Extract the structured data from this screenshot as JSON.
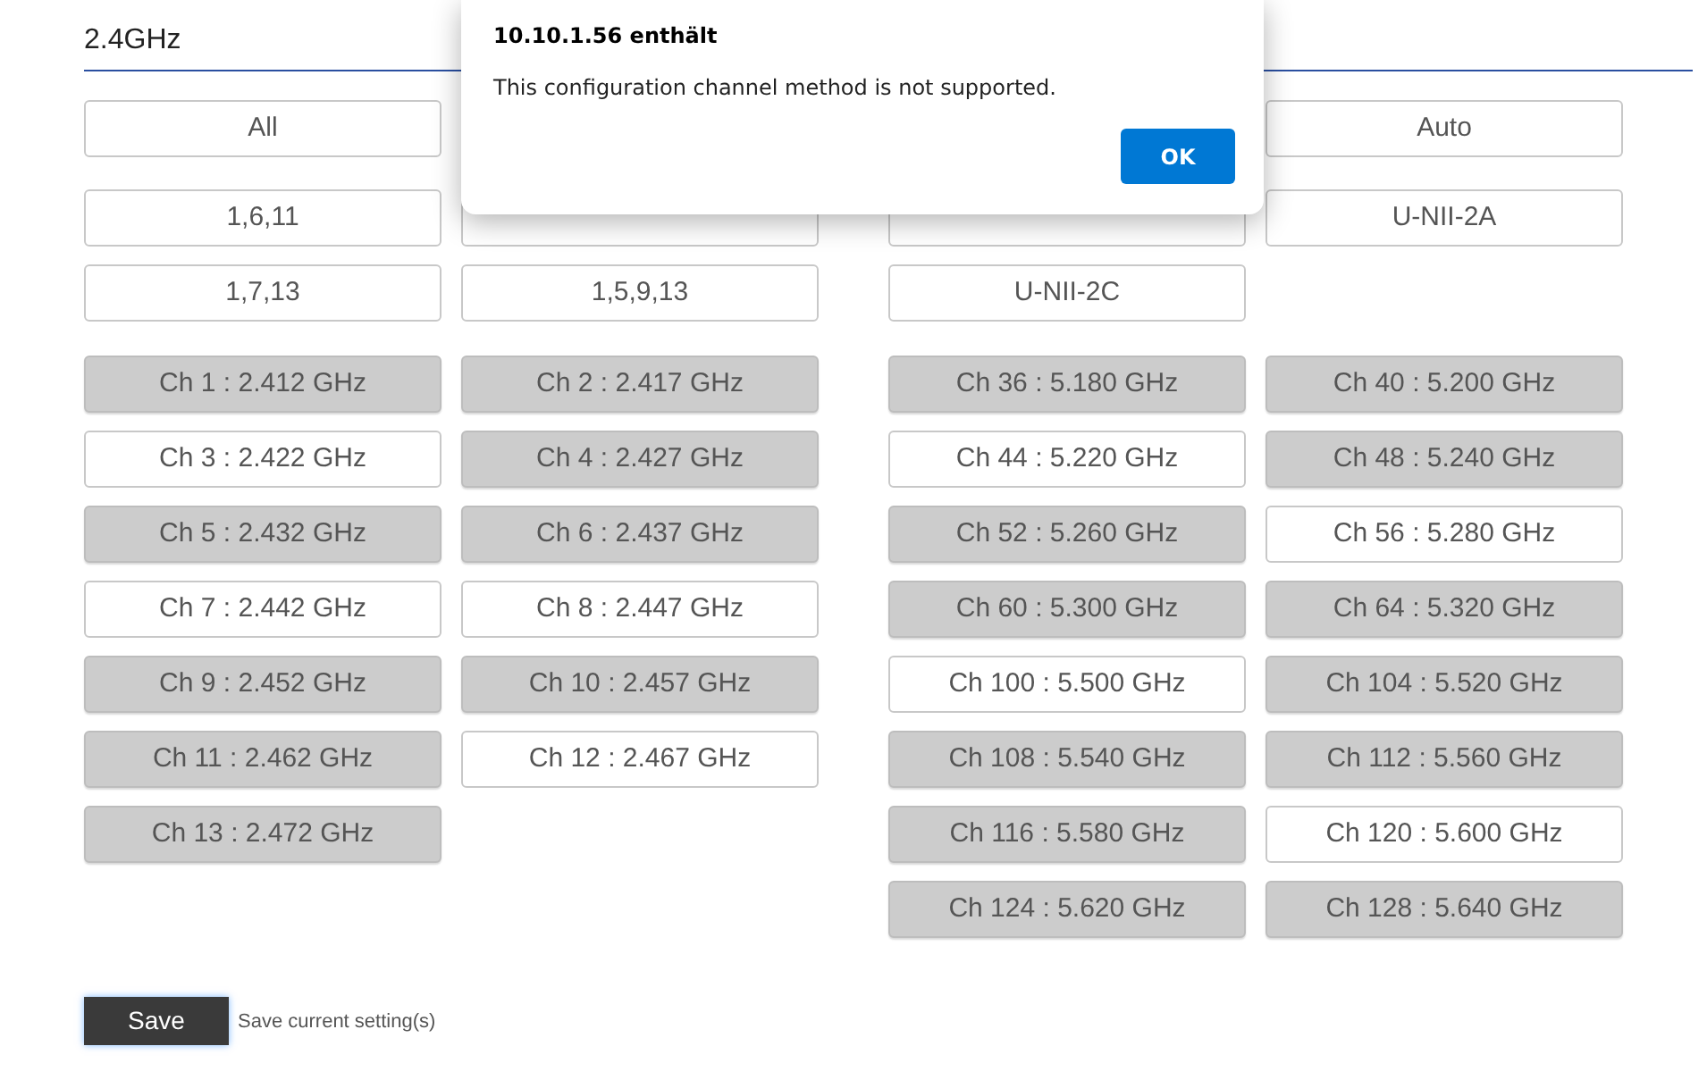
{
  "section": {
    "title": "2.4GHz"
  },
  "bands": [
    {
      "presets": [
        [
          {
            "kind": "button",
            "label": "All"
          }
        ],
        [
          {
            "kind": "button",
            "label": "1,6,11"
          },
          {
            "kind": "covered"
          }
        ],
        [
          {
            "kind": "button",
            "label": "1,7,13"
          },
          {
            "kind": "button",
            "label": "1,5,9,13"
          }
        ]
      ],
      "channels": [
        {
          "label": "Ch 1 : 2.412 GHz",
          "selected": true
        },
        {
          "label": "Ch 2 : 2.417 GHz",
          "selected": true
        },
        {
          "label": "Ch 3 : 2.422 GHz",
          "selected": false
        },
        {
          "label": "Ch 4 : 2.427 GHz",
          "selected": true
        },
        {
          "label": "Ch 5 : 2.432 GHz",
          "selected": true
        },
        {
          "label": "Ch 6 : 2.437 GHz",
          "selected": true
        },
        {
          "label": "Ch 7 : 2.442 GHz",
          "selected": false
        },
        {
          "label": "Ch 8 : 2.447 GHz",
          "selected": false
        },
        {
          "label": "Ch 9 : 2.452 GHz",
          "selected": true
        },
        {
          "label": "Ch 10 : 2.457 GHz",
          "selected": true
        },
        {
          "label": "Ch 11 : 2.462 GHz",
          "selected": true
        },
        {
          "label": "Ch 12 : 2.467 GHz",
          "selected": false
        },
        {
          "label": "Ch 13 : 2.472 GHz",
          "selected": true
        }
      ]
    },
    {
      "presets": [
        [
          {
            "kind": "gap"
          },
          {
            "kind": "button",
            "label": "Auto"
          }
        ],
        [
          {
            "kind": "covered"
          },
          {
            "kind": "button",
            "label": "U-NII-2A"
          }
        ],
        [
          {
            "kind": "button",
            "label": "U-NII-2C"
          }
        ]
      ],
      "channels": [
        {
          "label": "Ch 36 : 5.180 GHz",
          "selected": true
        },
        {
          "label": "Ch 40 : 5.200 GHz",
          "selected": true
        },
        {
          "label": "Ch 44 : 5.220 GHz",
          "selected": false
        },
        {
          "label": "Ch 48 : 5.240 GHz",
          "selected": true
        },
        {
          "label": "Ch 52 : 5.260 GHz",
          "selected": true
        },
        {
          "label": "Ch 56 : 5.280 GHz",
          "selected": false
        },
        {
          "label": "Ch 60 : 5.300 GHz",
          "selected": true
        },
        {
          "label": "Ch 64 : 5.320 GHz",
          "selected": true
        },
        {
          "label": "Ch 100 : 5.500 GHz",
          "selected": false
        },
        {
          "label": "Ch 104 : 5.520 GHz",
          "selected": true
        },
        {
          "label": "Ch 108 : 5.540 GHz",
          "selected": true
        },
        {
          "label": "Ch 112 : 5.560 GHz",
          "selected": true
        },
        {
          "label": "Ch 116 : 5.580 GHz",
          "selected": true
        },
        {
          "label": "Ch 120 : 5.600 GHz",
          "selected": false
        },
        {
          "label": "Ch 124 : 5.620 GHz",
          "selected": true
        },
        {
          "label": "Ch 128 : 5.640 GHz",
          "selected": true
        }
      ]
    }
  ],
  "save": {
    "label": "Save",
    "hint": "Save current setting(s)"
  },
  "dialog": {
    "title": "10.10.1.56 enthält",
    "message": "This configuration channel method is not supported.",
    "ok": "OK"
  }
}
